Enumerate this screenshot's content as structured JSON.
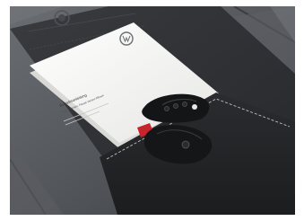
{
  "photo": {
    "subject": "Volkswagen owner's manual folder with two car keys on a leather car seat",
    "manual": {
      "title": "Betriebsanleitung",
      "subtitle": "Passat Variant, Passat Variant Alltrack"
    },
    "colors": {
      "seat": "#4d4f53",
      "folder": "#2f3134",
      "manual": "#f2f1ee",
      "keys": "#141517",
      "accent_red": "#c8242c"
    }
  }
}
